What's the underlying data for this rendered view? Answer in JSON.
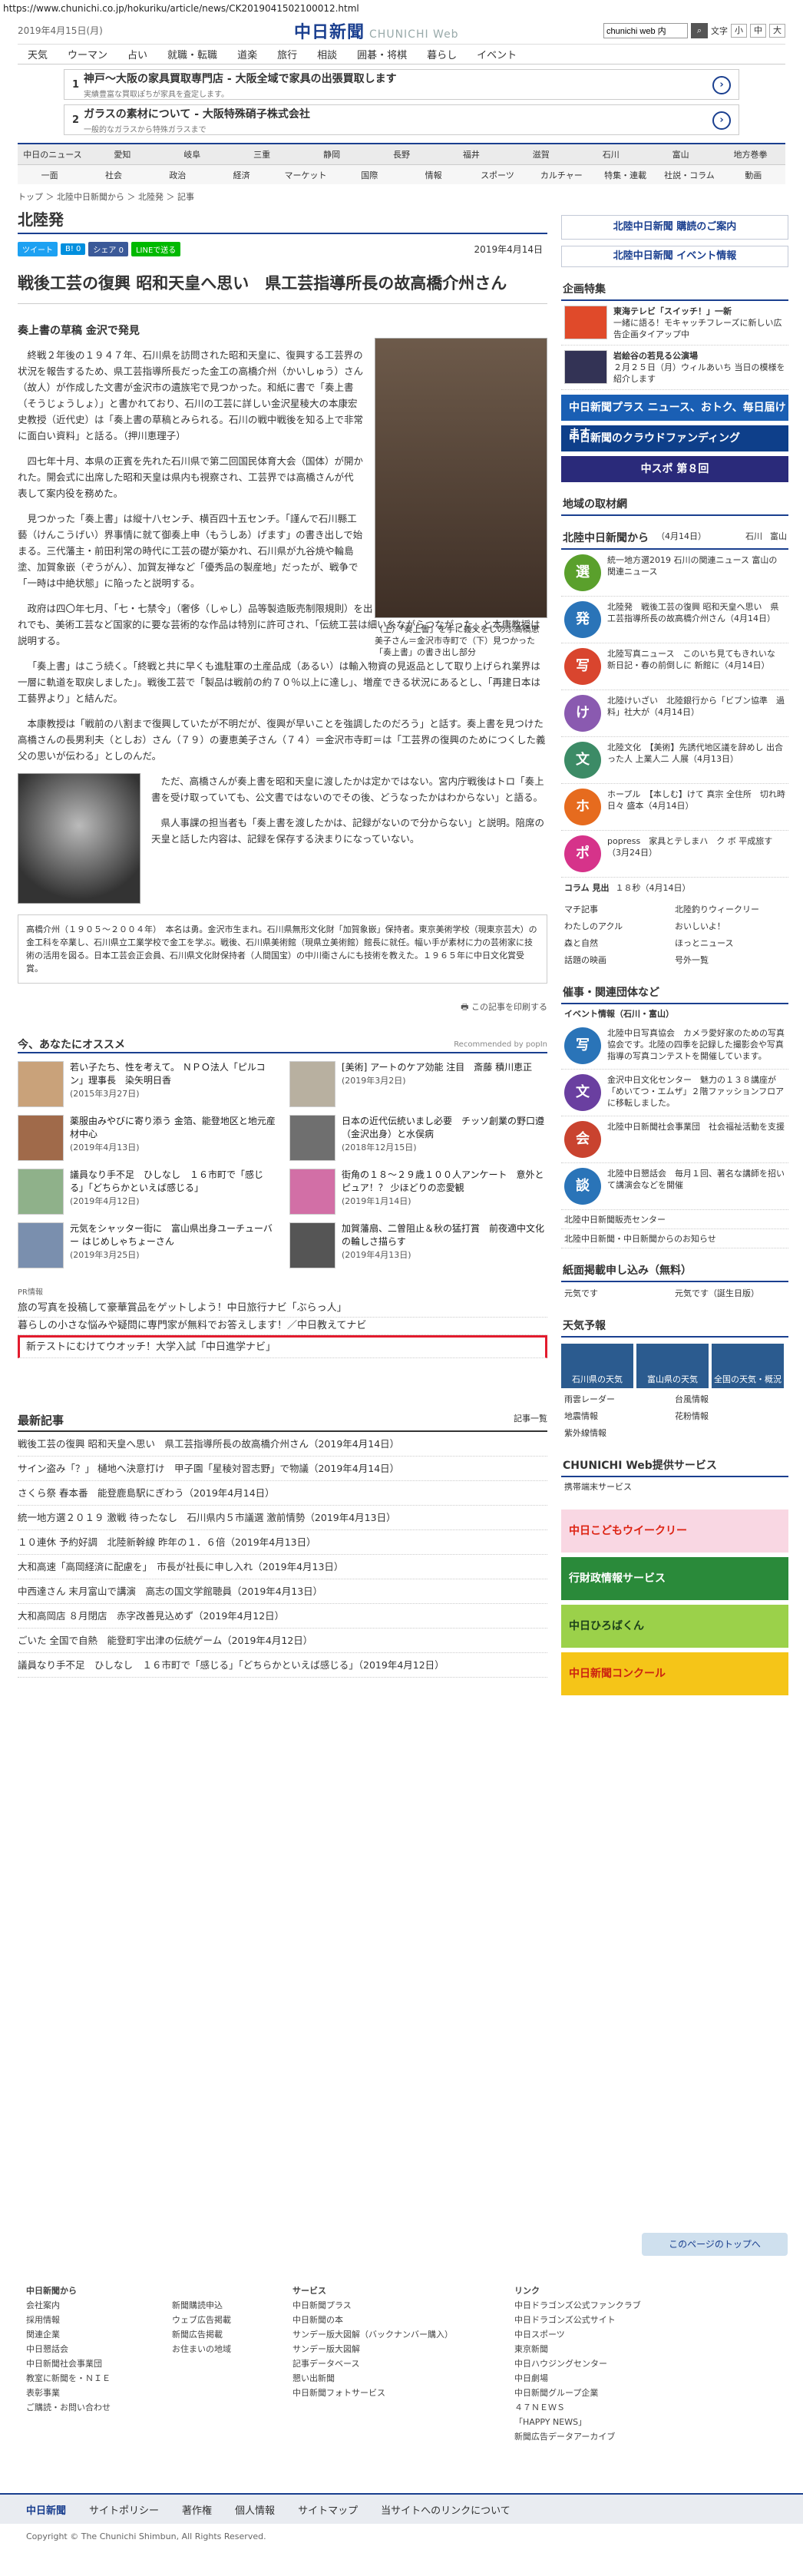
{
  "url": "https://www.chunichi.co.jp/hokuriku/article/news/CK2019041502100012.html",
  "header": {
    "date": "2019年4月15日(月)",
    "logo": "中日新聞",
    "logo_sub": "CHUNICHI Web",
    "search_value": "chunichi web 内",
    "font_label": "文字",
    "font_sizes": [
      "小",
      "中",
      "大"
    ]
  },
  "gnav": [
    "天気",
    "ウーマン",
    "占い",
    "就職・転職",
    "道楽",
    "旅行",
    "相談",
    "囲碁・将棋",
    "暮らし",
    "イベント"
  ],
  "ads": [
    {
      "num": "1",
      "title": "神戸～大阪の家具買取専門店 - 大阪全域で家具の出張買取します",
      "sub": "実績豊富な買取ぽちが家具を査定します。"
    },
    {
      "num": "2",
      "title": "ガラスの素材について - 大阪特殊硝子株式会社",
      "sub": "一般的なガラスから特殊ガラスまで"
    }
  ],
  "local_nav": [
    "中日のニュース",
    "愛知",
    "岐阜",
    "三重",
    "静岡",
    "長野",
    "福井",
    "滋賀",
    "石川",
    "富山",
    "地方巻拳"
  ],
  "cat_nav": [
    "一面",
    "社会",
    "政治",
    "経済",
    "マーケット",
    "国際",
    "情報",
    "スポーツ",
    "カルチャー",
    "特集・連載",
    "社説・コラム",
    "動画"
  ],
  "breadcrumb": "トップ ＞ 北陸中日新聞から ＞ 北陸発 ＞ 記事",
  "area_title": "北陸発",
  "share": {
    "tweet": "ツイート",
    "hatena": "B! 0",
    "fb": "シェア 0",
    "line": "LINEで送る",
    "date": "2019年4月14日"
  },
  "article": {
    "title": "戦後工芸の復興 昭和天皇へ思い　県工芸指導所長の故高橋介州さん",
    "subtitle": "奏上書の草稿 金沢で発見",
    "paragraphs": [
      "終戦２年後の１９４７年、石川県を訪問された昭和天皇に、復興する工芸界の状況を報告するため、県工芸指導所長だった金工の高橋介州（かいしゅう）さん（故人）が作成した文書が金沢市の遺族宅で見つかった。和紙に書で「奏上書（そうじょうしょ）」と書かれており、石川の工芸に詳しい金沢星稜大の本康宏史教授（近代史）は「奏上書の草稿とみられる。石川の戦中戦後を知る上で非常に面白い資料」と話る。（押川恵理子）",
      "四七年十月、本県の正賓を先れた石川県で第二回国民体育大会（国体）が開かれた。開会式に出席した昭和天皇は県内も視察され、工芸界では高橋さんが代表して案内役を務めた。",
      "見つかった「奏上書」は縦十八センチ、横百四十五センチ。「謹んで石川縣工藝（けんこうげい）界事情に就て御奏上申（もうしあ）げます」の書き出しで始まる。三代藩主・前田利常の時代に工芸の礎が築かれ、石川県が九谷焼や輪島塗、加賀象嵌（ぞうがん）、加賀友禅など「優秀品の製産地」だったが、戦争で「一時は中絶状態」に陥ったと説明する。",
      "政府は四〇年七月、「七・七禁令」（奢侈（しゃし）品等製造販売制限規則）を出し、ぜいたく品の製造・販売を禁止。これでも、美術工芸など国家的に要な芸術的な作品は特別に許可され、「伝統工芸は細い糸ながらつながった」と本康教授は説明する。",
      "「奏上書」はこう続く。「終戦と共に早くも進駐軍の土産品成（あるい）は輸入物資の見返品として取り上げられ業界は一層に軌道を取戻しました」。戦後工芸で「製品は戦前の約７０％以上に達し」、増産できる状況にあるとし、「再建日本は工藝界より」と結んだ。",
      "本康教授は「戦前の八割まで復興していたが不明だが、復興が早いことを強調したのだろう」と話す。奏上書を見つけた高橋さんの長男利夫（としお）さん（７９）の妻恵美子さん（７４）＝金沢市寺町＝は「工芸界の復興のためにつくした義父の思いが伝わる」としのんだ。",
      "ただ、高橋さんが奏上書を昭和天皇に渡したかは定かではない。宮内庁戦後はトロ「奏上書を受け取っていても、公文書ではないのでその後、どうなったかはわからない」と語る。",
      "県人事課の担当者も「奏上書を渡したかは、記録がないので分からない」と説明。陪席の天皇と話した内容は、記録を保存する決まりになっていない。"
    ],
    "photo_caption": "（上）「奏上書」を手に義父をしのぶ高橋恵美子さん＝金沢市寺町で（下）見つかった「奏上書」の書き出し部分",
    "bio": "高橋介州（１９０５～２００４年）　本名は勇。金沢市生まれ。石川県無形文化財「加賀象嵌」保持者。東京美術学校（現東京芸大）の金工科を卒業し、石川県立工業学校で金工を学ぶ。戦後、石川県美術館（現県立美術館）館長に就任。幅い手が素材に力の芸術家に技術の活用を図る。日本工芸会正会員、石川県文化財保持者（人間国宝）の中川衛さんにも技術を教えた。１９６５年に中日文化賞受賞。"
  },
  "print_label": "この記事を印刷する",
  "recommend": {
    "title": "今、あなたにオススメ",
    "provider": "Recommended by popIn",
    "items": [
      {
        "t": "若い子たち、性を考えて。 ＮＰＯ法人「ピルコン」理事長　染矢明日香",
        "d": "(2015年3月27日)"
      },
      {
        "t": "[美術] アートのケア効能 注目　斎藤 積川恵正",
        "d": "(2019年3月2日)"
      },
      {
        "t": "薬服由みやびに寄り添う 金箔、能登地区と地元産材中心",
        "d": "(2019年4月13日)"
      },
      {
        "t": "日本の近代伝統いまし必要　チッソ創業の野口遵（金沢出身）と水俣病",
        "d": "(2018年12月15日)"
      },
      {
        "t": "議員なり手不足　ひしなし　１６市町で「感じる」「どちらかといえば感じる」",
        "d": "(2019年4月12日)"
      },
      {
        "t": "街角の１８～２９歳１００人アンケート　意外とピュア！？ 少ほどりの恋愛観",
        "d": "(2019年1月14日)"
      },
      {
        "t": "元気をシャッター街に　富山県出身ユーチューバー はじめしゃちょーさん",
        "d": "(2019年3月25日)"
      },
      {
        "t": "加賀藩扇、二曽阻止＆秋の猛打賞　前夜適中文化の輪しさ描らす",
        "d": "(2019年4月13日)"
      }
    ]
  },
  "pr": {
    "label": "PR情報",
    "items": [
      "旅の写真を投稿して豪華賞品をゲットしよう！中日旅行ナビ「ぶらっ人」",
      "暮らしの小さな悩みや疑問に専門家が無料でお答えします！／中日教えてナビ",
      "新テストにむけてウオッチ！大学入試「中日進学ナビ」"
    ]
  },
  "latest": {
    "title": "最新記事",
    "more": "記事一覧",
    "items": [
      "戦後工芸の復興 昭和天皇へ思い　県工芸指導所長の故高橋介州さん（2019年4月14日）",
      "サイン盗み「？」 樋地ヘ決意打け　甲子園「星稜対習志野」で物議（2019年4月14日）",
      "さくら祭 春本番　能登鹿島駅にぎわう（2019年4月14日）",
      "統一地方選２０１９ 激戦 待ったなし　石川県内５市議選 激前情勢（2019年4月13日）",
      "１０連休 予約好調　北陸新幹線 昨年の１．６倍（2019年4月13日）",
      "大和高速「高岡経済に配慮を」　市長が社長に申し入れ（2019年4月13日）",
      "中西達さん 末月富山で講演　高志の国文学館聴員（2019年4月13日）",
      "大和高岡店 ８月閉店　赤字改善見込めず（2019年4月12日）",
      "ごいた 全国で自熱　能登町宇出津の伝統ゲーム（2019年4月12日）",
      "議員なり手不足　ひしなし　１６市町で「感じる」「どちらかといえば感じる」（2019年4月12日）"
    ]
  },
  "side": {
    "buy_btn": "北陸中日新聞 購読のご案内",
    "event_btn": "北陸中日新聞 イベント情報",
    "feature_title": "企画特集",
    "features": [
      {
        "t": "東海テレビ「スイッチ！」一新",
        "d": "一緒に語る！モキャッチフレーズに新しい広告企画タイアップ中"
      },
      {
        "t": "岩絵谷の若見る公演場",
        "d": "２月２５日（月）ウィルあいち 当日の模様を紹介します"
      }
    ],
    "banners": [
      "中日新聞プラス ニュース、おトク、毎日届けます",
      "中日新聞のクラウドファンディング",
      "中スポ 第８回"
    ],
    "local_title": "地域の取材網",
    "hokuriku_title": "北陸中日新聞から",
    "hokuriku_date": "（4月14日）",
    "tabs": [
      "石川",
      "富山"
    ],
    "hokuriku_items": [
      {
        "icon": "選",
        "c": "#5aa02c",
        "t": "統一地方選2019 石川の関連ニュース 富山の関連ニュース"
      },
      {
        "icon": "発",
        "c": "#2a74b8",
        "t": "北陸発　戦後工芸の復興 昭和天皇へ思い　県工芸指導所長の故高橋介州さん（4月14日）"
      },
      {
        "icon": "写",
        "c": "#d9452e",
        "t": "北陸写真ニュース　このいち見てもきれいな　新日記・春の前倒しに 新館に（4月14日）"
      },
      {
        "icon": "け",
        "c": "#8a5ab0",
        "t": "北陸けいざい　北陸銀行から「ビブン協準　過料」社大が（4月14日）"
      },
      {
        "icon": "文",
        "c": "#3c8b66",
        "t": "北陸文化　【美術】先誘代地区議を辞めし 出合った人 上業人二 人展（4月13日）"
      },
      {
        "icon": "ホ",
        "c": "#e66b1e",
        "t": "ホープル　【本しむ】けて 真宗 全住所　切れ時 日々 盛本（4月14日）"
      },
      {
        "icon": "ポ",
        "c": "#d6338a",
        "t": "popress　家具とテしまハ　ク ボ 平成旅す（3月24日）"
      }
    ],
    "column_label": "コラム 見出",
    "column_date": "１８秒（4月14日）",
    "links": [
      "マチ記事",
      "北陸釣りウィークリー",
      "わたしのアクル",
      "おいしいよ！",
      "森と自然",
      "ほっとニュース",
      "話題の映画",
      "号外一覧"
    ],
    "group_title": "催事・関連団体など",
    "event_title": "イベント情報（石川・富山）",
    "groups": [
      {
        "icon": "写",
        "c": "#2a74b8",
        "t": "北陸中日写真協会　カメラ愛好家のための写真協会です。北陸の四季を記録した撮影会や写真指導の写真コンテストを開催しています。"
      },
      {
        "icon": "文",
        "c": "#6a3fa0",
        "t": "金沢中日文化センター　魅力の１３８講座が「めいてつ・エムザ」２階ファッションフロアに移転しました。"
      },
      {
        "icon": "会",
        "c": "#c9432f",
        "t": "北陸中日新聞社会事業団　社会福祉活動を支援"
      },
      {
        "icon": "談",
        "c": "#2a74b8",
        "t": "北陸中日懇話会　毎月１回、著名な講師を招いて講演会などを開催"
      }
    ],
    "more_links": [
      "北陸中日新聞販売センター",
      "北陸中日新聞・中日新聞からのお知らせ"
    ],
    "apply_title": "紙面掲載申し込み（無料）",
    "apply_links": [
      "元気です",
      "元気です（誕生日版）"
    ],
    "weather_title": "天気予報",
    "weather": [
      "石川県の天気",
      "富山県の天気",
      "全国の天気・概況"
    ],
    "weather_links": [
      "雨雲レーダー",
      "台風情報",
      "地震情報",
      "花粉情報",
      "紫外線情報"
    ],
    "service_title": "CHUNICHI Web提供サービス",
    "service_link": "携帯端末サービス",
    "service_banners": [
      "中日こどもウイークリー",
      "行財政情報サービス",
      "中日ひろばくん",
      "中日新聞コンクール"
    ]
  },
  "footer": {
    "top": "このページのトップへ",
    "cols": [
      {
        "h": "中日新聞から",
        "i": [
          "会社案内",
          "採用情報",
          "関連企業",
          "中日懇話会",
          "中日新聞社会事業団",
          "教室に新聞を・ＮＩＥ",
          "表彰事業",
          "ご購読・お問い合わせ"
        ]
      },
      {
        "h": "",
        "i": [
          "新聞購読申込",
          "ウェブ広告掲載",
          "新聞広告掲載",
          "お住まいの地域"
        ]
      },
      {
        "h": "サービス",
        "i": [
          "中日新聞プラス",
          "中日新聞の本",
          "サンデー版大図解（バックナンバー購入）",
          "サンデー版大図解",
          "記事データベース",
          "懇い出新聞",
          "中日新聞フォトサービス"
        ]
      },
      {
        "h": "リンク",
        "i": [
          "中日ドラゴンズ公式ファンクラブ",
          "中日ドラゴンズ公式サイト",
          "中日スポーツ",
          "東京新聞",
          "中日ハウジングセンター",
          "中日劇場",
          "中日新聞グループ企業",
          "４７ＮＥＷＳ",
          "「HAPPY NEWS」",
          "新聞広告データアーカイブ"
        ]
      }
    ],
    "bar": [
      "中日新聞",
      "サイトポリシー",
      "著作権",
      "個人情報",
      "サイトマップ",
      "当サイトへのリンクについて"
    ],
    "copyright": "Copyright © The Chunichi Shimbun, All Rights Reserved."
  }
}
